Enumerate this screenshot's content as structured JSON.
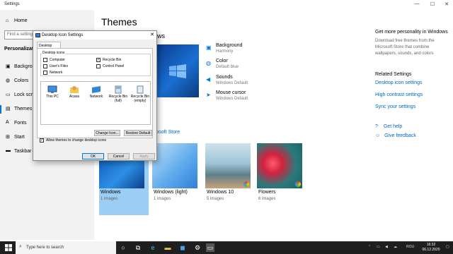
{
  "window": {
    "title": "Settings",
    "minimize": "—",
    "maximize": "☐",
    "close": "✕"
  },
  "sidebar": {
    "home": "Home",
    "find_placeholder": "Find a setting",
    "section": "Personalization",
    "items": [
      {
        "label": "Background",
        "icon": "image-icon"
      },
      {
        "label": "Colors",
        "icon": "palette-icon"
      },
      {
        "label": "Lock screen",
        "icon": "lock-screen-icon"
      },
      {
        "label": "Themes",
        "icon": "themes-icon"
      },
      {
        "label": "Fonts",
        "icon": "fonts-icon"
      },
      {
        "label": "Start",
        "icon": "start-icon"
      },
      {
        "label": "Taskbar",
        "icon": "taskbar-icon"
      }
    ]
  },
  "main": {
    "title": "Themes",
    "current_theme_label": "ws",
    "props": [
      {
        "name": "Background",
        "value": "Harmony"
      },
      {
        "name": "Color",
        "value": "Default blue"
      },
      {
        "name": "Sounds",
        "value": "Windows Default"
      },
      {
        "name": "Mouse cursor",
        "value": "Windows Default"
      }
    ],
    "store_link": "rosoft Store",
    "themes": [
      {
        "name": "Windows",
        "count": "1 images"
      },
      {
        "name": "Windows (light)",
        "count": "1 images"
      },
      {
        "name": "Windows 10",
        "count": "5 images"
      },
      {
        "name": "Flowers",
        "count": "6 images"
      }
    ]
  },
  "right": {
    "more_title": "Get more personality in Windows",
    "more_text_1": "Download free themes from the",
    "more_text_2": "Microsoft Store that combine",
    "more_text_3": "wallpapers, sounds, and colors",
    "related_title": "Related Settings",
    "links": [
      "Desktop icon settings",
      "High contrast settings",
      "Sync your settings"
    ],
    "help": "Get help",
    "feedback": "Give feedback"
  },
  "dialog": {
    "title": "Desktop Icon Settings",
    "tab": "Desktop Icons",
    "group_label": "Desktop icons",
    "checkboxes": [
      {
        "label": "Computer",
        "checked": ""
      },
      {
        "label": "Recycle Bin",
        "checked": "✓"
      },
      {
        "label": "User's Files",
        "checked": ""
      },
      {
        "label": "Control Panel",
        "checked": ""
      },
      {
        "label": "Network",
        "checked": ""
      }
    ],
    "icons": [
      {
        "label1": "This PC",
        "label2": ""
      },
      {
        "label1": "Acasa",
        "label2": ""
      },
      {
        "label1": "Network",
        "label2": ""
      },
      {
        "label1": "Recycle Bin",
        "label2": "(full)"
      },
      {
        "label1": "Recycle Bin",
        "label2": "(empty)"
      }
    ],
    "change_icon": "Change Icon...",
    "restore_default": "Restore Default",
    "allow_themes": "Allow themes to change desktop icons",
    "allow_checked": "✓",
    "ok": "OK",
    "cancel": "Cancel",
    "apply": "Apply"
  },
  "taskbar": {
    "search_placeholder": "Type here to search",
    "language": "ROU",
    "time": "16:32",
    "date": "06.12.2020"
  },
  "colors": {
    "accent": "#0078d7",
    "taskbar": "#1f1f1f",
    "selected_theme": "#9ccdf5"
  }
}
